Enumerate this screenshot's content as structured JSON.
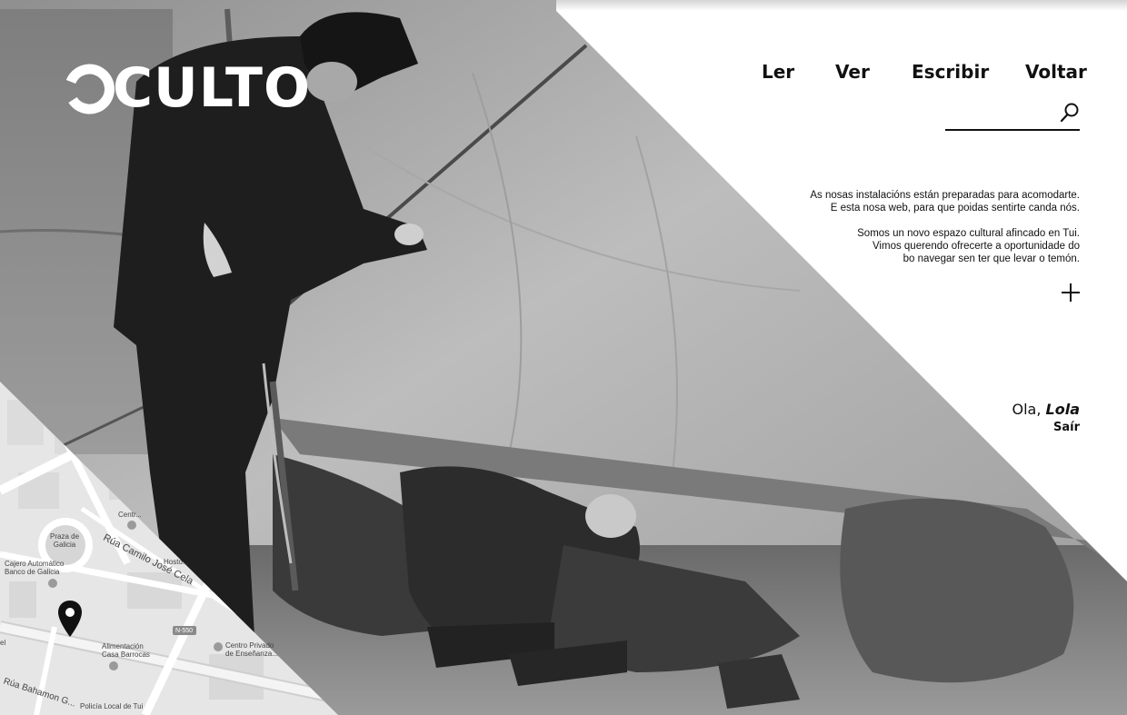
{
  "brand": {
    "logo_text": "CULTO",
    "logo_full": "OCULTO"
  },
  "nav": {
    "items": [
      "Ler",
      "Ver",
      "Escribir",
      "Voltar"
    ]
  },
  "search": {
    "value": "",
    "placeholder": ""
  },
  "intro": {
    "paragraph_1": "As nosas instalacións están preparadas para acomodarte.\nE esta nosa web, para que poidas sentirte canda nós.",
    "paragraph_2": "Somos un novo espazo cultural afincado en Tui.\nVimos querendo ofrecerte a oportunidade do\nbo navegar sen ter que levar o temón."
  },
  "user": {
    "greeting_prefix": "Ola, ",
    "name": "Lola",
    "logout_label": "Saír"
  },
  "map": {
    "labels": {
      "plaza": "Praza de\nGalicia",
      "atm": "Cajero Automático\nBanco de Galicia",
      "street_main": "Rúa Camilo José Cela",
      "road_code": "N-550",
      "shop": "Alimentación\nCasa Barrocas",
      "school": "Centro Privado\nde Enseñanza...",
      "police": "Policía Local de Tui",
      "street_bottom": "Rúa Bahamon G...",
      "centro": "Centr...",
      "hostal": "Hosto...",
      "edge_left": "el"
    }
  },
  "colors": {
    "accent": "#111111",
    "panel": "#ffffff",
    "map_bg": "#e6e6e6",
    "map_road": "#ffffff",
    "pin": "#111111"
  },
  "icons": {
    "search": "search-icon",
    "plus": "plus-icon",
    "pin": "map-pin-icon"
  }
}
